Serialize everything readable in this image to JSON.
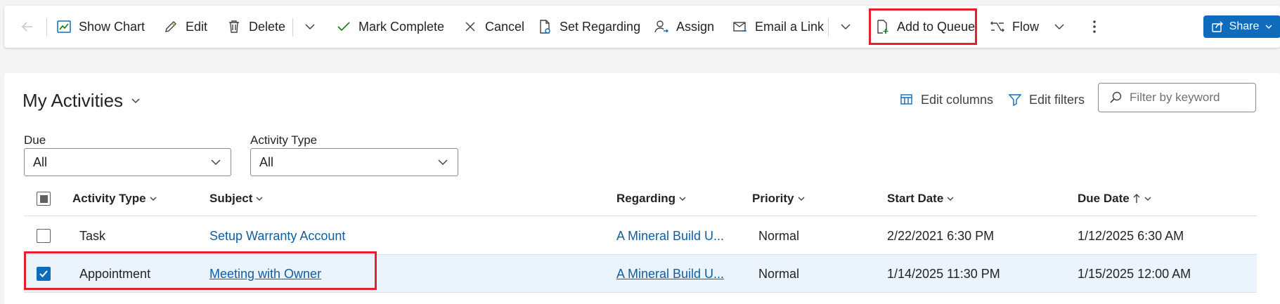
{
  "toolbar": {
    "show_chart": "Show Chart",
    "edit": "Edit",
    "delete": "Delete",
    "mark_complete": "Mark Complete",
    "cancel": "Cancel",
    "set_regarding": "Set Regarding",
    "assign": "Assign",
    "email_link": "Email a Link",
    "add_to_queue": "Add to Queue",
    "flow": "Flow",
    "share": "Share"
  },
  "view": {
    "title": "My Activities",
    "edit_columns": "Edit columns",
    "edit_filters": "Edit filters",
    "filter_placeholder": "Filter by keyword"
  },
  "filters": {
    "due_label": "Due",
    "due_value": "All",
    "type_label": "Activity Type",
    "type_value": "All"
  },
  "columns": [
    "Activity Type",
    "Subject",
    "Regarding",
    "Priority",
    "Start Date",
    "Due Date"
  ],
  "rows": [
    {
      "type": "Task",
      "subject": "Setup Warranty Account",
      "regarding": "A Mineral Build U...",
      "priority": "Normal",
      "start": "2/22/2021 6:30 PM",
      "due": "1/12/2025 6:30 AM",
      "selected": false
    },
    {
      "type": "Appointment",
      "subject": "Meeting with Owner",
      "regarding": "A Mineral Build U...",
      "priority": "Normal",
      "start": "1/14/2025 11:30 PM",
      "due": "1/15/2025 12:00 AM",
      "selected": true
    }
  ],
  "colors": {
    "accent": "#0f6cbd",
    "highlight": "#e3202b",
    "link": "#115ea3",
    "selected_row": "#ebf3fc"
  }
}
